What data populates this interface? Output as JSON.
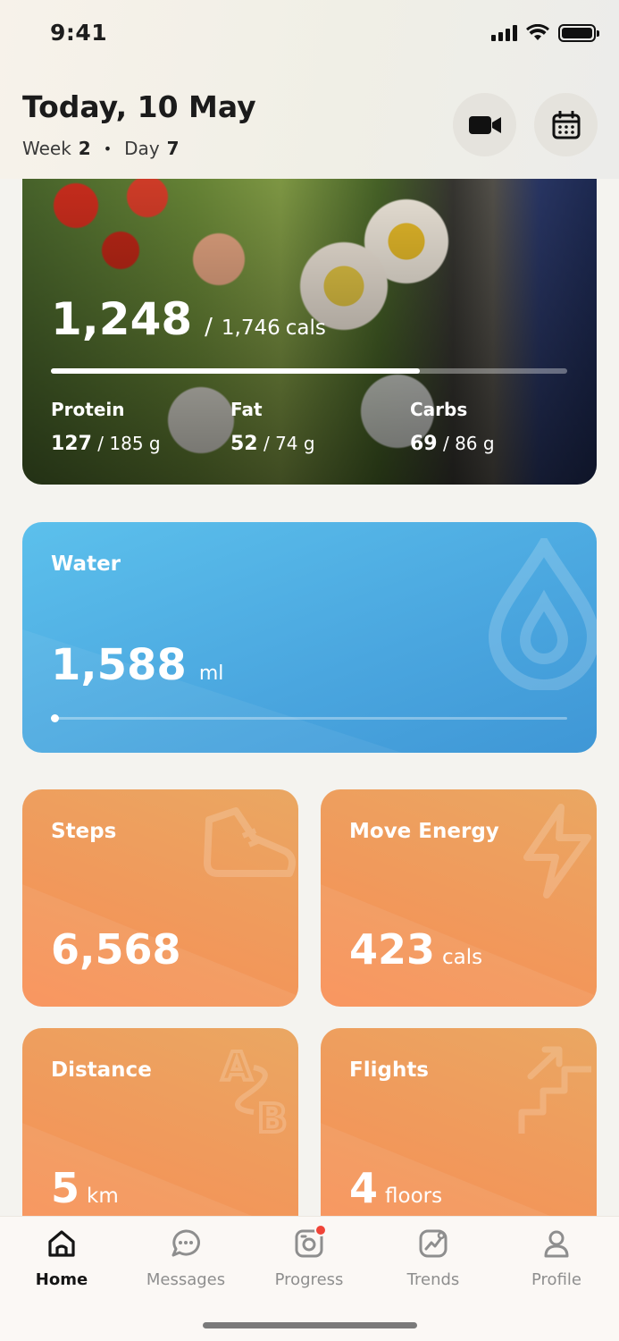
{
  "status_bar": {
    "time": "9:41"
  },
  "header": {
    "title": "Today, 10 May",
    "week_label": "Week",
    "week_value": "2",
    "day_label": "Day",
    "day_value": "7",
    "separator": "•",
    "video_icon": "video-camera-icon",
    "calendar_icon": "calendar-icon"
  },
  "nutrition": {
    "consumed": "1,248",
    "separator": "/",
    "goal": "1,746",
    "unit": "cals",
    "progress": 0.715,
    "macros": [
      {
        "label": "Protein",
        "value": "127",
        "goal": "/ 185 g"
      },
      {
        "label": "Fat",
        "value": "52",
        "goal": "/ 74 g"
      },
      {
        "label": "Carbs",
        "value": "69",
        "goal": "/ 86 g"
      }
    ]
  },
  "water": {
    "title": "Water",
    "value": "1,588",
    "unit": "ml",
    "progress": 0.0,
    "icon": "water-drop-icon",
    "color": "#4aa6df"
  },
  "tiles": {
    "steps": {
      "title": "Steps",
      "value": "6,568",
      "unit": "",
      "icon": "shoe-icon"
    },
    "move_energy": {
      "title": "Move Energy",
      "value": "423",
      "unit": "cals",
      "icon": "lightning-icon"
    },
    "distance": {
      "title": "Distance",
      "value": "5",
      "unit": "km",
      "icon": "a-to-b-icon"
    },
    "flights": {
      "title": "Flights",
      "value": "4",
      "unit": "floors",
      "icon": "stairs-icon"
    },
    "color": "#f49a5b"
  },
  "tabbar": {
    "items": [
      {
        "label": "Home",
        "icon": "home-icon",
        "active": true
      },
      {
        "label": "Messages",
        "icon": "chat-bubble-icon",
        "active": false
      },
      {
        "label": "Progress",
        "icon": "camera-progress-icon",
        "active": false,
        "badge": true
      },
      {
        "label": "Trends",
        "icon": "trend-chart-icon",
        "active": false
      },
      {
        "label": "Profile",
        "icon": "user-icon",
        "active": false
      }
    ]
  }
}
